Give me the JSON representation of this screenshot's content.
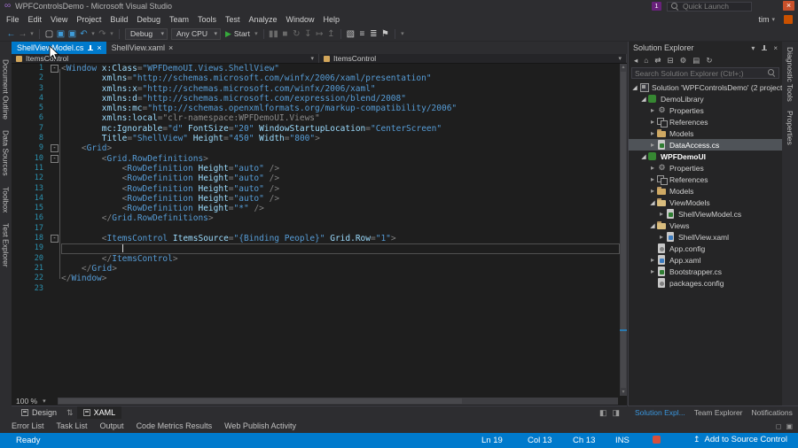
{
  "colors": {
    "accent": "#007acc",
    "editor_bg": "#1e1e1e",
    "chrome_bg": "#2d2d30",
    "panel_bg": "#252526",
    "selection_bg": "#4f5358",
    "line_number": "#2b91af",
    "tag": "#569cd6",
    "attribute": "#9cdcfe",
    "string": "#569cd6"
  },
  "icons": {
    "chevron_down": "▾",
    "close": "×",
    "minus": "-",
    "gear": "⚙",
    "tree_collapsed": "▸",
    "tree_expanded": "◢",
    "scroll_up": "▴",
    "scroll_down": "▾",
    "up_arrow": "↥",
    "swap": "⇅"
  },
  "title_bar": {
    "title": "WPFControlsDemo - Microsoft Visual Studio",
    "logo_glyph": "∞",
    "notification_badge": "1",
    "quick_launch_placeholder": "Quick Launch",
    "close_glyph": "×"
  },
  "menu_bar": {
    "items": [
      "File",
      "Edit",
      "View",
      "Project",
      "Build",
      "Debug",
      "Team",
      "Tools",
      "Test",
      "Analyze",
      "Window",
      "Help"
    ],
    "user": "tim"
  },
  "toolbar": {
    "items": [
      {
        "type": "icon",
        "name": "back-icon",
        "glyph": "←",
        "color": "#3f9bd8"
      },
      {
        "type": "icon",
        "name": "forward-icon",
        "glyph": "→",
        "color": "#7a7a7a"
      },
      {
        "type": "icon",
        "name": "nav-history-dropdown-icon",
        "glyph": "▾",
        "color": "#7a7a7a",
        "small": true
      },
      {
        "type": "sep"
      },
      {
        "type": "icon",
        "name": "new-file-icon",
        "glyph": "▢",
        "color": "#c8c8c8"
      },
      {
        "type": "icon",
        "name": "save-icon",
        "glyph": "▣",
        "color": "#3f9bd8"
      },
      {
        "type": "icon",
        "name": "save-all-icon",
        "glyph": "▣",
        "color": "#3f9bd8"
      },
      {
        "type": "icon",
        "name": "undo-icon",
        "glyph": "↶",
        "color": "#3f9bd8"
      },
      {
        "type": "icon",
        "name": "undo-dropdown-icon",
        "glyph": "▾",
        "color": "#7a7a7a",
        "small": true
      },
      {
        "type": "icon",
        "name": "redo-icon",
        "glyph": "↷",
        "color": "#6a6a6a"
      },
      {
        "type": "icon",
        "name": "redo-dropdown-icon",
        "glyph": "▾",
        "color": "#6a6a6a",
        "small": true
      },
      {
        "type": "sep"
      },
      {
        "type": "dropdown",
        "name": "configuration-dropdown",
        "label": "Debug",
        "width": 48
      },
      {
        "type": "dropdown",
        "name": "platform-dropdown",
        "label": "Any CPU",
        "width": 56
      },
      {
        "type": "start",
        "name": "start-button",
        "label": "Start",
        "glyph": "▶",
        "color": "#36a93c"
      },
      {
        "type": "icon",
        "name": "start-dropdown-icon",
        "glyph": "▾",
        "color": "#7a7a7a",
        "small": true
      },
      {
        "type": "sep"
      },
      {
        "type": "icon",
        "name": "break-all-icon",
        "glyph": "▮▮",
        "color": "#6a6a6a"
      },
      {
        "type": "icon",
        "name": "stop-icon",
        "glyph": "■",
        "color": "#6a6a6a"
      },
      {
        "type": "icon",
        "name": "restart-icon",
        "glyph": "↻",
        "color": "#6a6a6a"
      },
      {
        "type": "icon",
        "name": "step-into-icon",
        "glyph": "↧",
        "color": "#6a6a6a"
      },
      {
        "type": "icon",
        "name": "step-over-icon",
        "glyph": "↦",
        "color": "#6a6a6a"
      },
      {
        "type": "icon",
        "name": "step-out-icon",
        "glyph": "↥",
        "color": "#6a6a6a"
      },
      {
        "type": "sep"
      },
      {
        "type": "icon",
        "name": "find-in-files-icon",
        "glyph": "▧",
        "color": "#c8c8c8"
      },
      {
        "type": "icon",
        "name": "comment-icon",
        "glyph": "≡",
        "color": "#c8c8c8"
      },
      {
        "type": "icon",
        "name": "uncomment-icon",
        "glyph": "≣",
        "color": "#c8c8c8"
      },
      {
        "type": "icon",
        "name": "bookmark-icon",
        "glyph": "⚑",
        "color": "#c8c8c8"
      },
      {
        "type": "sep"
      },
      {
        "type": "icon",
        "name": "toolbar-options-icon",
        "glyph": "▾",
        "color": "#7a7a7a",
        "small": true
      }
    ]
  },
  "editor": {
    "tabs": [
      {
        "label": "ShellViewModel.cs",
        "active": true
      },
      {
        "label": "ShellView.xaml",
        "active": false
      }
    ],
    "breadcrumb": {
      "left_label": "ItemsControl",
      "right_label": "ItemsControl"
    },
    "zoom_level": "100 %",
    "caret": {
      "line": 19,
      "col": 13
    },
    "lines": [
      {
        "n": 1,
        "fold": true,
        "tokens": [
          [
            "d",
            "<"
          ],
          [
            "t",
            "Window"
          ],
          [
            "p",
            " "
          ],
          [
            "a",
            "x:Class"
          ],
          [
            "d",
            "="
          ],
          [
            "s",
            "\"WPFDemoUI.Views.ShellView\""
          ]
        ]
      },
      {
        "n": 2,
        "tokens": [
          [
            "p",
            "        "
          ],
          [
            "a",
            "xmlns"
          ],
          [
            "d",
            "="
          ],
          [
            "s",
            "\"http://schemas.microsoft.com/winfx/2006/xaml/presentation\""
          ]
        ]
      },
      {
        "n": 3,
        "tokens": [
          [
            "p",
            "        "
          ],
          [
            "a",
            "xmlns:x"
          ],
          [
            "d",
            "="
          ],
          [
            "s",
            "\"http://schemas.microsoft.com/winfx/2006/xaml\""
          ]
        ]
      },
      {
        "n": 4,
        "tokens": [
          [
            "p",
            "        "
          ],
          [
            "a",
            "xmlns:d"
          ],
          [
            "d",
            "="
          ],
          [
            "s",
            "\"http://schemas.microsoft.com/expression/blend/2008\""
          ]
        ]
      },
      {
        "n": 5,
        "tokens": [
          [
            "p",
            "        "
          ],
          [
            "a",
            "xmlns:mc"
          ],
          [
            "d",
            "="
          ],
          [
            "s",
            "\"http://schemas.openxmlformats.org/markup-compatibility/2006\""
          ]
        ]
      },
      {
        "n": 6,
        "tokens": [
          [
            "p",
            "        "
          ],
          [
            "a",
            "xmlns:local"
          ],
          [
            "d",
            "="
          ],
          [
            "g",
            "\"clr-namespace:WPFDemoUI.Views\""
          ]
        ]
      },
      {
        "n": 7,
        "tokens": [
          [
            "p",
            "        "
          ],
          [
            "a",
            "mc:Ignorable"
          ],
          [
            "d",
            "="
          ],
          [
            "s",
            "\"d\""
          ],
          [
            "p",
            " "
          ],
          [
            "a",
            "FontSize"
          ],
          [
            "d",
            "="
          ],
          [
            "s",
            "\"20\""
          ],
          [
            "p",
            " "
          ],
          [
            "a",
            "WindowStartupLocation"
          ],
          [
            "d",
            "="
          ],
          [
            "s",
            "\"CenterScreen\""
          ]
        ]
      },
      {
        "n": 8,
        "tokens": [
          [
            "p",
            "        "
          ],
          [
            "a",
            "Title"
          ],
          [
            "d",
            "="
          ],
          [
            "s",
            "\"ShellView\""
          ],
          [
            "p",
            " "
          ],
          [
            "a",
            "Height"
          ],
          [
            "d",
            "="
          ],
          [
            "s",
            "\"450\""
          ],
          [
            "p",
            " "
          ],
          [
            "a",
            "Width"
          ],
          [
            "d",
            "="
          ],
          [
            "s",
            "\"800\""
          ],
          [
            "d",
            ">"
          ]
        ]
      },
      {
        "n": 9,
        "fold": true,
        "tokens": [
          [
            "p",
            "    "
          ],
          [
            "d",
            "<"
          ],
          [
            "t",
            "Grid"
          ],
          [
            "d",
            ">"
          ]
        ]
      },
      {
        "n": 10,
        "fold": true,
        "tokens": [
          [
            "p",
            "        "
          ],
          [
            "d",
            "<"
          ],
          [
            "t",
            "Grid.RowDefinitions"
          ],
          [
            "d",
            ">"
          ]
        ]
      },
      {
        "n": 11,
        "tokens": [
          [
            "p",
            "            "
          ],
          [
            "d",
            "<"
          ],
          [
            "t",
            "RowDefinition"
          ],
          [
            "p",
            " "
          ],
          [
            "a",
            "Height"
          ],
          [
            "d",
            "="
          ],
          [
            "s",
            "\"auto\""
          ],
          [
            "p",
            " "
          ],
          [
            "d",
            "/>"
          ]
        ]
      },
      {
        "n": 12,
        "tokens": [
          [
            "p",
            "            "
          ],
          [
            "d",
            "<"
          ],
          [
            "t",
            "RowDefinition"
          ],
          [
            "p",
            " "
          ],
          [
            "a",
            "Height"
          ],
          [
            "d",
            "="
          ],
          [
            "s",
            "\"auto\""
          ],
          [
            "p",
            " "
          ],
          [
            "d",
            "/>"
          ]
        ]
      },
      {
        "n": 13,
        "tokens": [
          [
            "p",
            "            "
          ],
          [
            "d",
            "<"
          ],
          [
            "t",
            "RowDefinition"
          ],
          [
            "p",
            " "
          ],
          [
            "a",
            "Height"
          ],
          [
            "d",
            "="
          ],
          [
            "s",
            "\"auto\""
          ],
          [
            "p",
            " "
          ],
          [
            "d",
            "/>"
          ]
        ]
      },
      {
        "n": 14,
        "tokens": [
          [
            "p",
            "            "
          ],
          [
            "d",
            "<"
          ],
          [
            "t",
            "RowDefinition"
          ],
          [
            "p",
            " "
          ],
          [
            "a",
            "Height"
          ],
          [
            "d",
            "="
          ],
          [
            "s",
            "\"auto\""
          ],
          [
            "p",
            " "
          ],
          [
            "d",
            "/>"
          ]
        ]
      },
      {
        "n": 15,
        "tokens": [
          [
            "p",
            "            "
          ],
          [
            "d",
            "<"
          ],
          [
            "t",
            "RowDefinition"
          ],
          [
            "p",
            " "
          ],
          [
            "a",
            "Height"
          ],
          [
            "d",
            "="
          ],
          [
            "s",
            "\"*\""
          ],
          [
            "p",
            " "
          ],
          [
            "d",
            "/>"
          ]
        ]
      },
      {
        "n": 16,
        "tokens": [
          [
            "p",
            "        "
          ],
          [
            "d",
            "</"
          ],
          [
            "t",
            "Grid.RowDefinitions"
          ],
          [
            "d",
            ">"
          ]
        ]
      },
      {
        "n": 17,
        "tokens": []
      },
      {
        "n": 18,
        "fold": true,
        "tokens": [
          [
            "p",
            "        "
          ],
          [
            "d",
            "<"
          ],
          [
            "t",
            "ItemsControl"
          ],
          [
            "p",
            " "
          ],
          [
            "a",
            "ItemsSource"
          ],
          [
            "d",
            "="
          ],
          [
            "s",
            "\"{Binding People}\""
          ],
          [
            "p",
            " "
          ],
          [
            "a",
            "Grid.Row"
          ],
          [
            "d",
            "="
          ],
          [
            "s",
            "\"1\""
          ],
          [
            "d",
            ">"
          ]
        ]
      },
      {
        "n": 19,
        "cur": true,
        "tokens": []
      },
      {
        "n": 20,
        "tokens": [
          [
            "p",
            "        "
          ],
          [
            "d",
            "</"
          ],
          [
            "t",
            "ItemsControl"
          ],
          [
            "d",
            ">"
          ]
        ]
      },
      {
        "n": 21,
        "tokens": [
          [
            "p",
            "    "
          ],
          [
            "d",
            "</"
          ],
          [
            "t",
            "Grid"
          ],
          [
            "d",
            ">"
          ]
        ]
      },
      {
        "n": 22,
        "tokens": [
          [
            "d",
            "</"
          ],
          [
            "t",
            "Window"
          ],
          [
            "d",
            ">"
          ]
        ]
      },
      {
        "n": 23,
        "tokens": []
      }
    ]
  },
  "left_strip": {
    "items": [
      "Document Outline",
      "Data Sources",
      "Toolbox",
      "Test Explorer"
    ]
  },
  "right_strip": {
    "items": [
      "Diagnostic Tools",
      "Properties"
    ]
  },
  "design_xaml_bar": {
    "design_label": "Design",
    "xaml_label": "XAML",
    "swap_icon": "⇅",
    "split_icons": [
      {
        "name": "split-horizontal-icon",
        "glyph": "◧"
      },
      {
        "name": "split-vertical-icon",
        "glyph": "◨"
      }
    ]
  },
  "solution_explorer": {
    "title": "Solution Explorer",
    "search_placeholder": "Search Solution Explorer (Ctrl+;)",
    "toolbar_icons": [
      {
        "name": "back-icon",
        "glyph": "◂"
      },
      {
        "name": "home-icon",
        "glyph": "⌂"
      },
      {
        "name": "sync-active-document-icon",
        "glyph": "⇄"
      },
      {
        "name": "collapse-all-icon",
        "glyph": "⊟"
      },
      {
        "name": "properties-icon",
        "glyph": "⚙"
      },
      {
        "name": "show-all-files-icon",
        "glyph": "▤"
      },
      {
        "name": "refresh-icon",
        "glyph": "↻"
      }
    ],
    "tree": [
      {
        "label": "Solution 'WPFControlsDemo' (2 projects)",
        "icon": "solution",
        "indent": 0,
        "expand": "open"
      },
      {
        "label": "DemoLibrary",
        "icon": "csproj",
        "indent": 1,
        "expand": "open"
      },
      {
        "label": "Properties",
        "icon": "props",
        "indent": 2,
        "expand": "closed"
      },
      {
        "label": "References",
        "icon": "refs",
        "indent": 2,
        "expand": "closed"
      },
      {
        "label": "Models",
        "icon": "folder",
        "indent": 2,
        "expand": "closed"
      },
      {
        "label": "DataAccess.cs",
        "icon": "cs",
        "indent": 2,
        "expand": "closed",
        "selected": true
      },
      {
        "label": "WPFDemoUI",
        "icon": "csproj",
        "indent": 1,
        "expand": "open",
        "bold": true
      },
      {
        "label": "Properties",
        "icon": "props",
        "indent": 2,
        "expand": "closed"
      },
      {
        "label": "References",
        "icon": "refs",
        "indent": 2,
        "expand": "closed"
      },
      {
        "label": "Models",
        "icon": "folder",
        "indent": 2,
        "expand": "closed"
      },
      {
        "label": "ViewModels",
        "icon": "folder-open",
        "indent": 2,
        "expand": "open"
      },
      {
        "label": "ShellViewModel.cs",
        "icon": "cs",
        "indent": 3,
        "expand": "closed"
      },
      {
        "label": "Views",
        "icon": "folder-open",
        "indent": 2,
        "expand": "open"
      },
      {
        "label": "ShellView.xaml",
        "icon": "xaml",
        "indent": 3,
        "expand": "closed"
      },
      {
        "label": "App.config",
        "icon": "config",
        "indent": 2,
        "expand": "none"
      },
      {
        "label": "App.xaml",
        "icon": "xaml",
        "indent": 2,
        "expand": "closed"
      },
      {
        "label": "Bootstrapper.cs",
        "icon": "cs",
        "indent": 2,
        "expand": "closed"
      },
      {
        "label": "packages.config",
        "icon": "config",
        "indent": 2,
        "expand": "none"
      }
    ],
    "bottom_tabs": [
      {
        "label": "Solution Expl...",
        "active": true
      },
      {
        "label": "Team Explorer",
        "active": false
      },
      {
        "label": "Notifications",
        "active": false
      }
    ]
  },
  "panel_tabs": {
    "items": [
      "Error List",
      "Task List",
      "Output",
      "Code Metrics Results",
      "Web Publish Activity"
    ],
    "window_icons": [
      {
        "name": "auto-hide-icon",
        "glyph": "◻"
      },
      {
        "name": "layout-icon",
        "glyph": "▣"
      }
    ]
  },
  "status_bar": {
    "ready": "Ready",
    "line": "Ln 19",
    "column": "Col 13",
    "character": "Ch 13",
    "mode": "INS",
    "source_control": "Add to Source Control"
  }
}
